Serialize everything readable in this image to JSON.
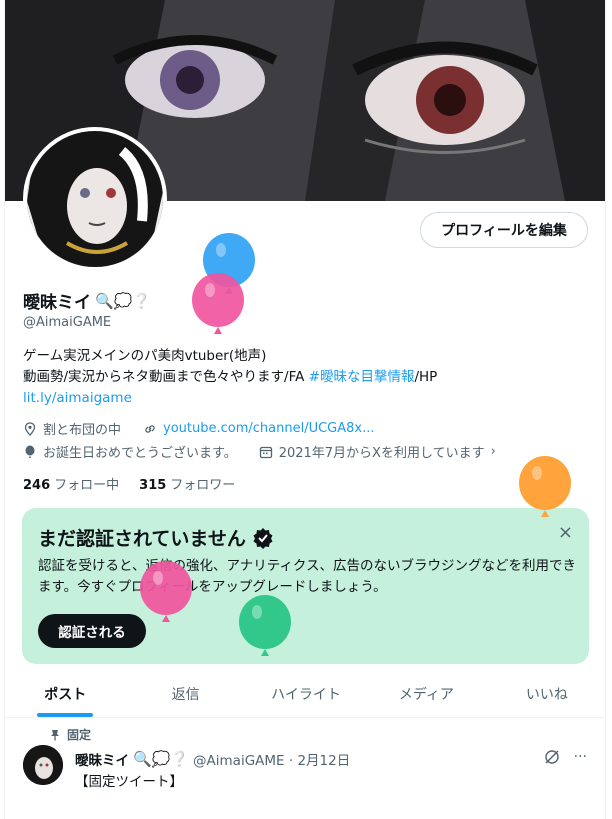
{
  "profile": {
    "edit_button": "プロフィールを編集",
    "name": "曖昧ミイ",
    "name_emoji": "🔍💭❔",
    "handle": "@AimaiGAME",
    "bio_line1": "ゲーム実況メインのパ美肉vtuber(地声)",
    "bio_line2_prefix": "動画勢/実況からネタ動画まで色々やります/FA ",
    "bio_hashtag": "#曖昧な目撃情報",
    "bio_line2_suffix": "/HP",
    "bio_link": "lit.ly/aimaigame",
    "location": "割と布団の中",
    "website": "youtube.com/channel/UCGA8x...",
    "birthday": "お誕生日おめでとうございます。",
    "joined": "2021年7月からXを利用しています",
    "following_count": "246",
    "following_label": "フォロー中",
    "followers_count": "315",
    "followers_label": "フォロワー"
  },
  "verify": {
    "title": "まだ認証されていません",
    "text": "認証を受けると、返信の強化、アナリティクス、広告のないブラウジングなどを利用できます。今すぐプロフィールをアップグレードしましょう。",
    "button": "認証される",
    "close": "×"
  },
  "tabs": [
    "ポスト",
    "返信",
    "ハイライト",
    "メディア",
    "いいね"
  ],
  "post": {
    "pinned_label": "固定",
    "name": "曖昧ミイ",
    "name_emoji": "🔍💭❔",
    "handle_date": "@AimaiGAME · 2月12日",
    "text": "【固定ツイート】",
    "more": "···"
  },
  "colors": {
    "accent": "#1d9bf0",
    "verify_bg": "#c5f0db",
    "balloon_blue": "#3fa9f5",
    "balloon_pink": "#f0559e",
    "balloon_orange": "#ffa33d",
    "balloon_green": "#32c88c"
  }
}
